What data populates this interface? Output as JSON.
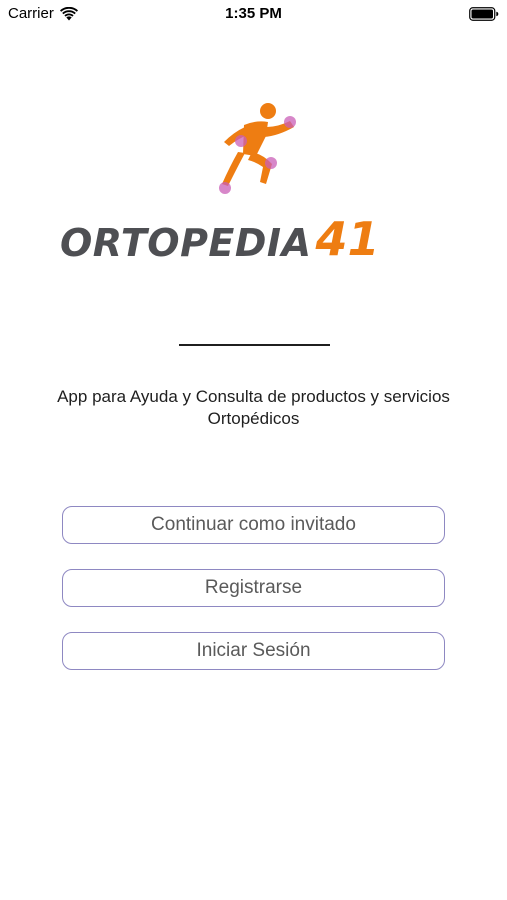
{
  "status_bar": {
    "carrier": "Carrier",
    "time": "1:35 PM",
    "icons": [
      "wifi-icon",
      "battery-icon"
    ]
  },
  "logo": {
    "brand_name": "ORTOPEDIA",
    "brand_number": "41",
    "colors": {
      "text": "#4e4f53",
      "accent": "#ee7d12",
      "joints": "#c95fb7"
    }
  },
  "description": "App para Ayuda y Consulta de productos y servicios Ortopédicos",
  "buttons": {
    "guest": "Continuar como invitado",
    "register": "Registrarse",
    "login": "Iniciar Sesión"
  },
  "colors": {
    "button_border": "#8e88c2",
    "button_text": "#5a5a5a",
    "background": "#ffffff"
  }
}
